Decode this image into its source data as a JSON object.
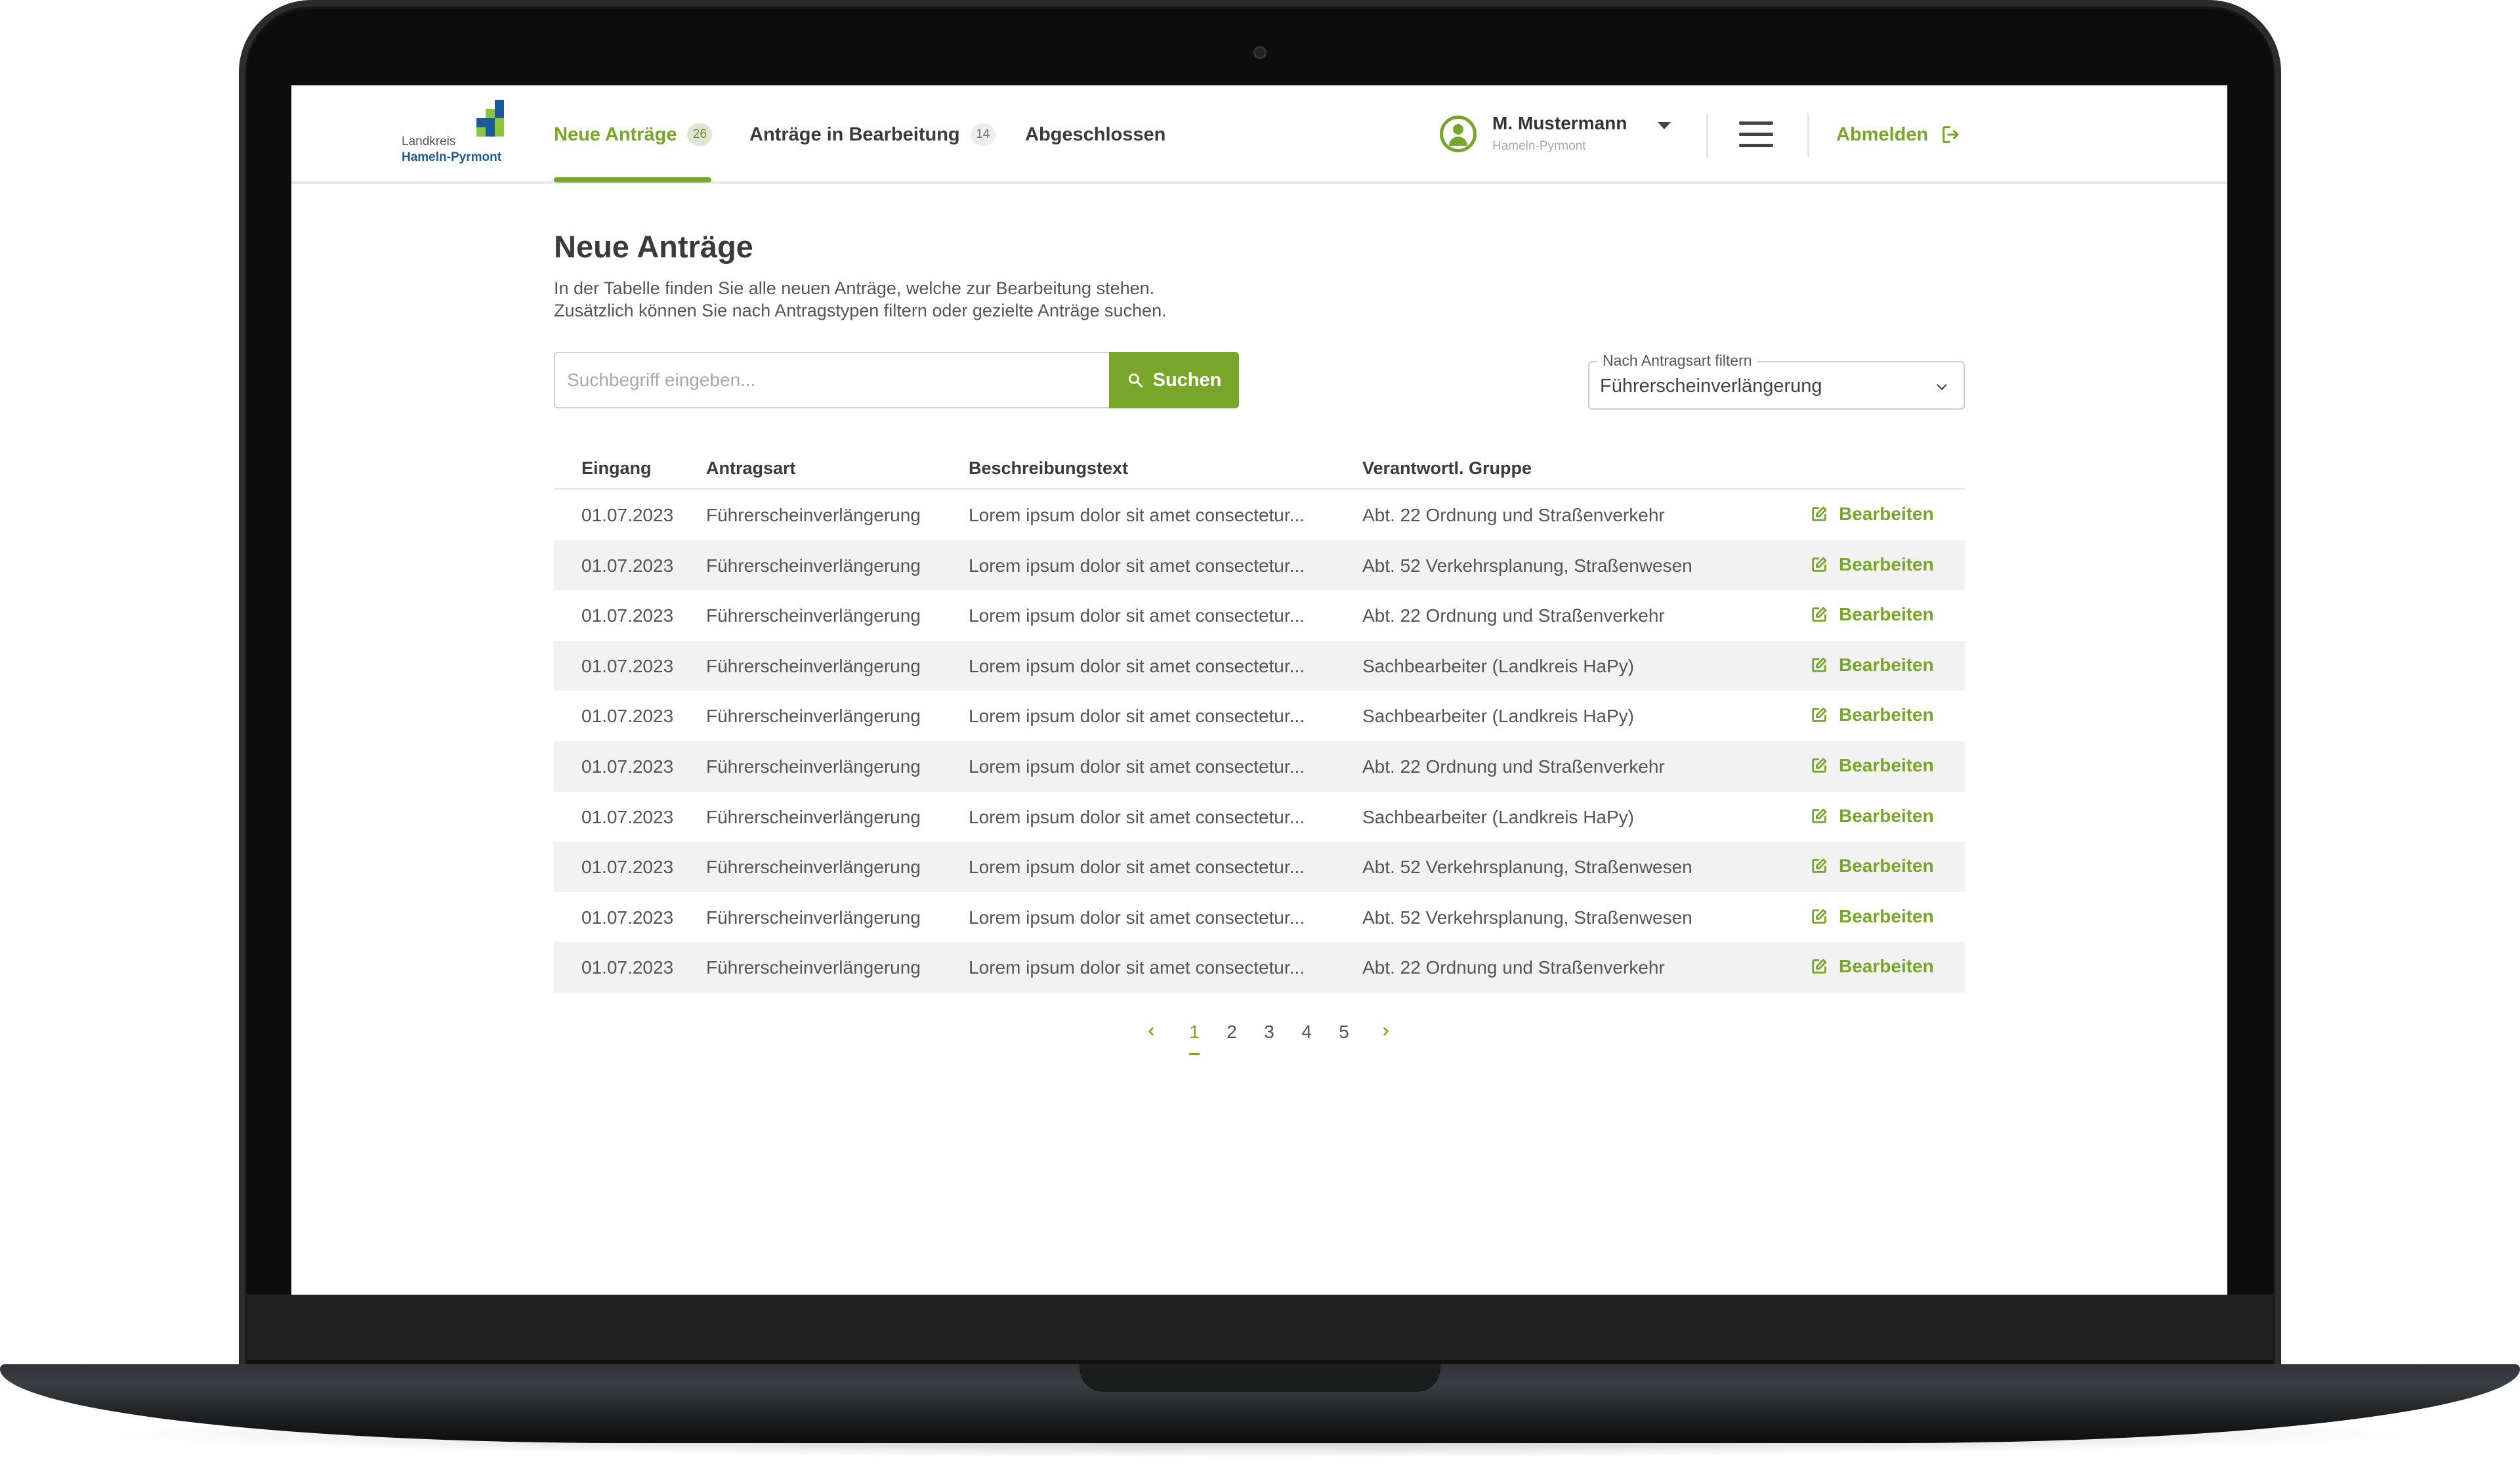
{
  "app": {
    "logo_line1": "Landkreis",
    "logo_line2": "Hameln-Pyrmont"
  },
  "nav": {
    "tabs": [
      {
        "label": "Neue Anträge",
        "badge": "26",
        "active": true
      },
      {
        "label": "Anträge in Bearbeitung",
        "badge": "14",
        "active": false
      },
      {
        "label": "Abgeschlossen",
        "badge": "",
        "active": false
      }
    ]
  },
  "user": {
    "name": "M. Mustermann",
    "org": "Hameln-Pyrmont"
  },
  "header": {
    "logout_label": "Abmelden"
  },
  "page": {
    "title": "Neue Anträge",
    "description_line1": "In der Tabelle finden Sie alle neuen Anträge, welche zur Bearbeitung stehen.",
    "description_line2": "Zusätzlich können Sie nach Antragstypen filtern oder gezielte Anträge suchen."
  },
  "search": {
    "placeholder": "Suchbegriff eingeben...",
    "button_label": "Suchen"
  },
  "filter": {
    "label": "Nach Antragsart filtern",
    "value": "Führerscheinverlängerung"
  },
  "table": {
    "headers": [
      "Eingang",
      "Antragsart",
      "Beschreibungstext",
      "Verantwortl. Gruppe"
    ],
    "action_label": "Bearbeiten",
    "rows": [
      {
        "eingang": "01.07.2023",
        "antragsart": "Führerscheinverlängerung",
        "beschreibung": "Lorem ipsum dolor sit amet consectetur...",
        "gruppe": "Abt. 22 Ordnung und Straßenverkehr"
      },
      {
        "eingang": "01.07.2023",
        "antragsart": "Führerscheinverlängerung",
        "beschreibung": "Lorem ipsum dolor sit amet consectetur...",
        "gruppe": "Abt. 52 Verkehrsplanung, Straßenwesen"
      },
      {
        "eingang": "01.07.2023",
        "antragsart": "Führerscheinverlängerung",
        "beschreibung": "Lorem ipsum dolor sit amet consectetur...",
        "gruppe": "Abt. 22 Ordnung und Straßenverkehr"
      },
      {
        "eingang": "01.07.2023",
        "antragsart": "Führerscheinverlängerung",
        "beschreibung": "Lorem ipsum dolor sit amet consectetur...",
        "gruppe": "Sachbearbeiter (Landkreis HaPy)"
      },
      {
        "eingang": "01.07.2023",
        "antragsart": "Führerscheinverlängerung",
        "beschreibung": "Lorem ipsum dolor sit amet consectetur...",
        "gruppe": "Sachbearbeiter (Landkreis HaPy)"
      },
      {
        "eingang": "01.07.2023",
        "antragsart": "Führerscheinverlängerung",
        "beschreibung": "Lorem ipsum dolor sit amet consectetur...",
        "gruppe": "Abt. 22 Ordnung und Straßenverkehr"
      },
      {
        "eingang": "01.07.2023",
        "antragsart": "Führerscheinverlängerung",
        "beschreibung": "Lorem ipsum dolor sit amet consectetur...",
        "gruppe": "Sachbearbeiter (Landkreis HaPy)"
      },
      {
        "eingang": "01.07.2023",
        "antragsart": "Führerscheinverlängerung",
        "beschreibung": "Lorem ipsum dolor sit amet consectetur...",
        "gruppe": "Abt. 52 Verkehrsplanung, Straßenwesen"
      },
      {
        "eingang": "01.07.2023",
        "antragsart": "Führerscheinverlängerung",
        "beschreibung": "Lorem ipsum dolor sit amet consectetur...",
        "gruppe": "Abt. 52 Verkehrsplanung, Straßenwesen"
      },
      {
        "eingang": "01.07.2023",
        "antragsart": "Führerscheinverlängerung",
        "beschreibung": "Lorem ipsum dolor sit amet consectetur...",
        "gruppe": "Abt. 22 Ordnung und Straßenverkehr"
      }
    ]
  },
  "pagination": {
    "pages": [
      "1",
      "2",
      "3",
      "4",
      "5"
    ],
    "current": "1"
  },
  "colors": {
    "accent": "#78a62a",
    "logo_blue": "#1d5a9a",
    "logo_green": "#8cc63f",
    "row_alt": "#f2f2f2"
  },
  "icons": {
    "search": "search-icon",
    "edit": "edit-icon",
    "logout": "logout-icon",
    "menu": "hamburger-menu-icon",
    "user": "user-circle-icon",
    "caret": "caret-down-icon",
    "chevron": "chevron-down-icon"
  }
}
